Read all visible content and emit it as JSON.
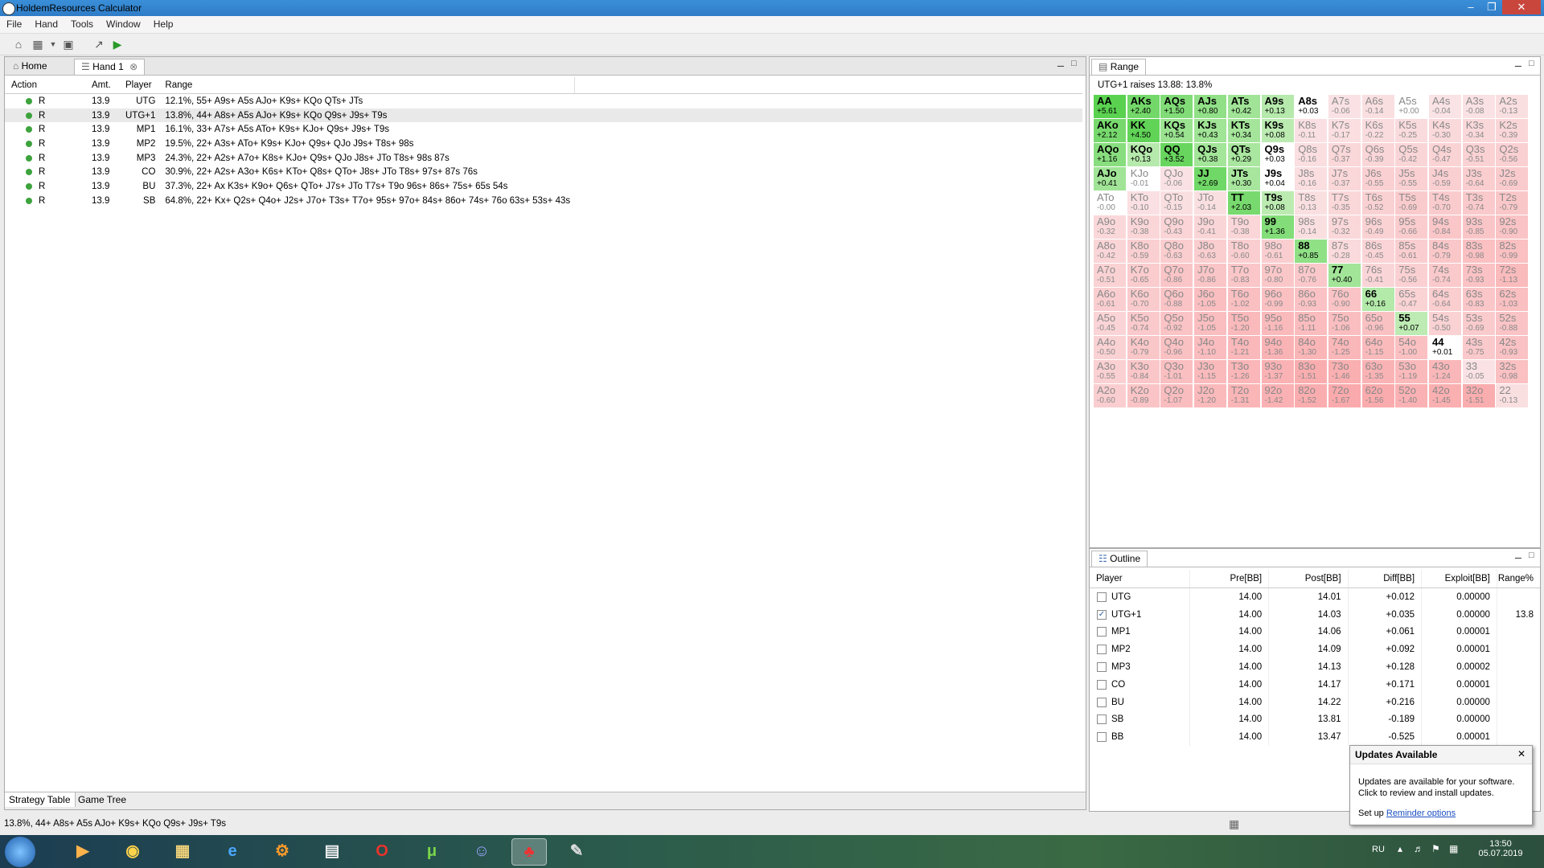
{
  "window": {
    "title": "HoldemResources Calculator"
  },
  "menu": [
    "File",
    "Hand",
    "Tools",
    "Window",
    "Help"
  ],
  "tabs": {
    "home": "Home",
    "hand": "Hand 1"
  },
  "strategy": {
    "headers": [
      "Action",
      "Amt.",
      "Player",
      "Range"
    ],
    "rows": [
      {
        "action": "R",
        "amt": "13.9",
        "player": "UTG",
        "range": "12.1%, 55+ A9s+ A5s AJo+ K9s+ KQo QTs+ JTs"
      },
      {
        "action": "R",
        "amt": "13.9",
        "player": "UTG+1",
        "range": "13.8%, 44+ A8s+ A5s AJo+ K9s+ KQo Q9s+ J9s+ T9s"
      },
      {
        "action": "R",
        "amt": "13.9",
        "player": "MP1",
        "range": "16.1%, 33+ A7s+ A5s ATo+ K9s+ KJo+ Q9s+ J9s+ T9s"
      },
      {
        "action": "R",
        "amt": "13.9",
        "player": "MP2",
        "range": "19.5%, 22+ A3s+ ATo+ K9s+ KJo+ Q9s+ QJo J9s+ T8s+ 98s"
      },
      {
        "action": "R",
        "amt": "13.9",
        "player": "MP3",
        "range": "24.3%, 22+ A2s+ A7o+ K8s+ KJo+ Q9s+ QJo J8s+ JTo T8s+ 98s 87s"
      },
      {
        "action": "R",
        "amt": "13.9",
        "player": "CO",
        "range": "30.9%, 22+ A2s+ A3o+ K6s+ KTo+ Q8s+ QTo+ J8s+ JTo T8s+ 97s+ 87s 76s"
      },
      {
        "action": "R",
        "amt": "13.9",
        "player": "BU",
        "range": "37.3%, 22+ Ax K3s+ K9o+ Q6s+ QTo+ J7s+ JTo T7s+ T9o 96s+ 86s+ 75s+ 65s 54s"
      },
      {
        "action": "R",
        "amt": "13.9",
        "player": "SB",
        "range": "64.8%, 22+ Kx+ Q2s+ Q4o+ J2s+ J7o+ T3s+ T7o+ 95s+ 97o+ 84s+ 86o+ 74s+ 76o 63s+ 53s+ 43s"
      }
    ],
    "bottom_tabs": [
      "Strategy Table",
      "Game Tree"
    ]
  },
  "range_panel": {
    "title": "Range",
    "subtitle": "UTG+1 raises 13.88: 13.8%",
    "grid": [
      [
        [
          "AA",
          "+5.61"
        ],
        [
          "AKs",
          "+2.40"
        ],
        [
          "AQs",
          "+1.50"
        ],
        [
          "AJs",
          "+0.80"
        ],
        [
          "ATs",
          "+0.42"
        ],
        [
          "A9s",
          "+0.13"
        ],
        [
          "A8s",
          "+0.03"
        ],
        [
          "A7s",
          "-0.06"
        ],
        [
          "A6s",
          "-0.14"
        ],
        [
          "A5s",
          "+0.00"
        ],
        [
          "A4s",
          "-0.04"
        ],
        [
          "A3s",
          "-0.08"
        ],
        [
          "A2s",
          "-0.13"
        ]
      ],
      [
        [
          "AKo",
          "+2.12"
        ],
        [
          "KK",
          "+4.50"
        ],
        [
          "KQs",
          "+0.54"
        ],
        [
          "KJs",
          "+0.43"
        ],
        [
          "KTs",
          "+0.34"
        ],
        [
          "K9s",
          "+0.08"
        ],
        [
          "K8s",
          "-0.11"
        ],
        [
          "K7s",
          "-0.17"
        ],
        [
          "K6s",
          "-0.22"
        ],
        [
          "K5s",
          "-0.25"
        ],
        [
          "K4s",
          "-0.30"
        ],
        [
          "K3s",
          "-0.34"
        ],
        [
          "K2s",
          "-0.39"
        ]
      ],
      [
        [
          "AQo",
          "+1.16"
        ],
        [
          "KQo",
          "+0.13"
        ],
        [
          "QQ",
          "+3.52"
        ],
        [
          "QJs",
          "+0.38"
        ],
        [
          "QTs",
          "+0.29"
        ],
        [
          "Q9s",
          "+0.03"
        ],
        [
          "Q8s",
          "-0.16"
        ],
        [
          "Q7s",
          "-0.37"
        ],
        [
          "Q6s",
          "-0.39"
        ],
        [
          "Q5s",
          "-0.42"
        ],
        [
          "Q4s",
          "-0.47"
        ],
        [
          "Q3s",
          "-0.51"
        ],
        [
          "Q2s",
          "-0.56"
        ]
      ],
      [
        [
          "AJo",
          "+0.41"
        ],
        [
          "KJo",
          "-0.01"
        ],
        [
          "QJo",
          "-0.06"
        ],
        [
          "JJ",
          "+2.69"
        ],
        [
          "JTs",
          "+0.30"
        ],
        [
          "J9s",
          "+0.04"
        ],
        [
          "J8s",
          "-0.16"
        ],
        [
          "J7s",
          "-0.37"
        ],
        [
          "J6s",
          "-0.55"
        ],
        [
          "J5s",
          "-0.55"
        ],
        [
          "J4s",
          "-0.59"
        ],
        [
          "J3s",
          "-0.64"
        ],
        [
          "J2s",
          "-0.69"
        ]
      ],
      [
        [
          "ATo",
          "-0.00"
        ],
        [
          "KTo",
          "-0.10"
        ],
        [
          "QTo",
          "-0.15"
        ],
        [
          "JTo",
          "-0.14"
        ],
        [
          "TT",
          "+2.03"
        ],
        [
          "T9s",
          "+0.08"
        ],
        [
          "T8s",
          "-0.13"
        ],
        [
          "T7s",
          "-0.35"
        ],
        [
          "T6s",
          "-0.52"
        ],
        [
          "T5s",
          "-0.69"
        ],
        [
          "T4s",
          "-0.70"
        ],
        [
          "T3s",
          "-0.74"
        ],
        [
          "T2s",
          "-0.79"
        ]
      ],
      [
        [
          "A9o",
          "-0.32"
        ],
        [
          "K9o",
          "-0.38"
        ],
        [
          "Q9o",
          "-0.43"
        ],
        [
          "J9o",
          "-0.41"
        ],
        [
          "T9o",
          "-0.38"
        ],
        [
          "99",
          "+1.36"
        ],
        [
          "98s",
          "-0.14"
        ],
        [
          "97s",
          "-0.32"
        ],
        [
          "96s",
          "-0.49"
        ],
        [
          "95s",
          "-0.66"
        ],
        [
          "94s",
          "-0.84"
        ],
        [
          "93s",
          "-0.85"
        ],
        [
          "92s",
          "-0.90"
        ]
      ],
      [
        [
          "A8o",
          "-0.42"
        ],
        [
          "K8o",
          "-0.59"
        ],
        [
          "Q8o",
          "-0.63"
        ],
        [
          "J8o",
          "-0.63"
        ],
        [
          "T8o",
          "-0.60"
        ],
        [
          "98o",
          "-0.61"
        ],
        [
          "88",
          "+0.85"
        ],
        [
          "87s",
          "-0.28"
        ],
        [
          "86s",
          "-0.45"
        ],
        [
          "85s",
          "-0.61"
        ],
        [
          "84s",
          "-0.79"
        ],
        [
          "83s",
          "-0.98"
        ],
        [
          "82s",
          "-0.99"
        ]
      ],
      [
        [
          "A7o",
          "-0.51"
        ],
        [
          "K7o",
          "-0.65"
        ],
        [
          "Q7o",
          "-0.86"
        ],
        [
          "J7o",
          "-0.86"
        ],
        [
          "T7o",
          "-0.83"
        ],
        [
          "97o",
          "-0.80"
        ],
        [
          "87o",
          "-0.76"
        ],
        [
          "77",
          "+0.40"
        ],
        [
          "76s",
          "-0.41"
        ],
        [
          "75s",
          "-0.56"
        ],
        [
          "74s",
          "-0.74"
        ],
        [
          "73s",
          "-0.93"
        ],
        [
          "72s",
          "-1.13"
        ]
      ],
      [
        [
          "A6o",
          "-0.61"
        ],
        [
          "K6o",
          "-0.70"
        ],
        [
          "Q6o",
          "-0.88"
        ],
        [
          "J6o",
          "-1.05"
        ],
        [
          "T6o",
          "-1.02"
        ],
        [
          "96o",
          "-0.99"
        ],
        [
          "86o",
          "-0.93"
        ],
        [
          "76o",
          "-0.90"
        ],
        [
          "66",
          "+0.16"
        ],
        [
          "65s",
          "-0.47"
        ],
        [
          "64s",
          "-0.64"
        ],
        [
          "63s",
          "-0.83"
        ],
        [
          "62s",
          "-1.03"
        ]
      ],
      [
        [
          "A5o",
          "-0.45"
        ],
        [
          "K5o",
          "-0.74"
        ],
        [
          "Q5o",
          "-0.92"
        ],
        [
          "J5o",
          "-1.05"
        ],
        [
          "T5o",
          "-1.20"
        ],
        [
          "95o",
          "-1.16"
        ],
        [
          "85o",
          "-1.11"
        ],
        [
          "75o",
          "-1.06"
        ],
        [
          "65o",
          "-0.96"
        ],
        [
          "55",
          "+0.07"
        ],
        [
          "54s",
          "-0.50"
        ],
        [
          "53s",
          "-0.69"
        ],
        [
          "52s",
          "-0.88"
        ]
      ],
      [
        [
          "A4o",
          "-0.50"
        ],
        [
          "K4o",
          "-0.79"
        ],
        [
          "Q4o",
          "-0.96"
        ],
        [
          "J4o",
          "-1.10"
        ],
        [
          "T4o",
          "-1.21"
        ],
        [
          "94o",
          "-1.36"
        ],
        [
          "84o",
          "-1.30"
        ],
        [
          "74o",
          "-1.25"
        ],
        [
          "64o",
          "-1.15"
        ],
        [
          "54o",
          "-1.00"
        ],
        [
          "44",
          "+0.01"
        ],
        [
          "43s",
          "-0.75"
        ],
        [
          "42s",
          "-0.93"
        ]
      ],
      [
        [
          "A3o",
          "-0.55"
        ],
        [
          "K3o",
          "-0.84"
        ],
        [
          "Q3o",
          "-1.01"
        ],
        [
          "J3o",
          "-1.15"
        ],
        [
          "T3o",
          "-1.26"
        ],
        [
          "93o",
          "-1.37"
        ],
        [
          "83o",
          "-1.51"
        ],
        [
          "73o",
          "-1.46"
        ],
        [
          "63o",
          "-1.35"
        ],
        [
          "53o",
          "-1.19"
        ],
        [
          "43o",
          "-1.24"
        ],
        [
          "33",
          "-0.05"
        ],
        [
          "32s",
          "-0.98"
        ]
      ],
      [
        [
          "A2o",
          "-0.60"
        ],
        [
          "K2o",
          "-0.89"
        ],
        [
          "Q2o",
          "-1.07"
        ],
        [
          "J2o",
          "-1.20"
        ],
        [
          "T2o",
          "-1.31"
        ],
        [
          "92o",
          "-1.42"
        ],
        [
          "82o",
          "-1.52"
        ],
        [
          "72o",
          "-1.67"
        ],
        [
          "62o",
          "-1.56"
        ],
        [
          "52o",
          "-1.40"
        ],
        [
          "42o",
          "-1.45"
        ],
        [
          "32o",
          "-1.51"
        ],
        [
          "22",
          "-0.13"
        ]
      ]
    ]
  },
  "outline": {
    "title": "Outline",
    "headers": [
      "Player",
      "Pre[BB]",
      "Post[BB]",
      "Diff[BB]",
      "Exploit[BB]",
      "Range%"
    ],
    "rows": [
      {
        "player": "UTG",
        "pre": "14.00",
        "post": "14.01",
        "diff": "+0.012",
        "exploit": "0.00000",
        "range": "",
        "checked": false
      },
      {
        "player": "UTG+1",
        "pre": "14.00",
        "post": "14.03",
        "diff": "+0.035",
        "exploit": "0.00000",
        "range": "13.8",
        "checked": true
      },
      {
        "player": "MP1",
        "pre": "14.00",
        "post": "14.06",
        "diff": "+0.061",
        "exploit": "0.00001",
        "range": "",
        "checked": false
      },
      {
        "player": "MP2",
        "pre": "14.00",
        "post": "14.09",
        "diff": "+0.092",
        "exploit": "0.00001",
        "range": "",
        "checked": false
      },
      {
        "player": "MP3",
        "pre": "14.00",
        "post": "14.13",
        "diff": "+0.128",
        "exploit": "0.00002",
        "range": "",
        "checked": false
      },
      {
        "player": "CO",
        "pre": "14.00",
        "post": "14.17",
        "diff": "+0.171",
        "exploit": "0.00001",
        "range": "",
        "checked": false
      },
      {
        "player": "BU",
        "pre": "14.00",
        "post": "14.22",
        "diff": "+0.216",
        "exploit": "0.00000",
        "range": "",
        "checked": false
      },
      {
        "player": "SB",
        "pre": "14.00",
        "post": "13.81",
        "diff": "-0.189",
        "exploit": "0.00000",
        "range": "",
        "checked": false
      },
      {
        "player": "BB",
        "pre": "14.00",
        "post": "13.47",
        "diff": "-0.525",
        "exploit": "0.00001",
        "range": "",
        "checked": false
      }
    ]
  },
  "status_text": "13.8%, 44+ A8s+ A5s AJo+ K9s+ KQo Q9s+ J9s+ T9s",
  "popup": {
    "title": "Updates Available",
    "line1": "Updates are available for your software.",
    "line2": "Click to review and install updates.",
    "setup_prefix": "Set up",
    "link": "Reminder options"
  },
  "taskbar": {
    "lang": "RU",
    "time": "13:50",
    "date": "05.07.2019"
  }
}
